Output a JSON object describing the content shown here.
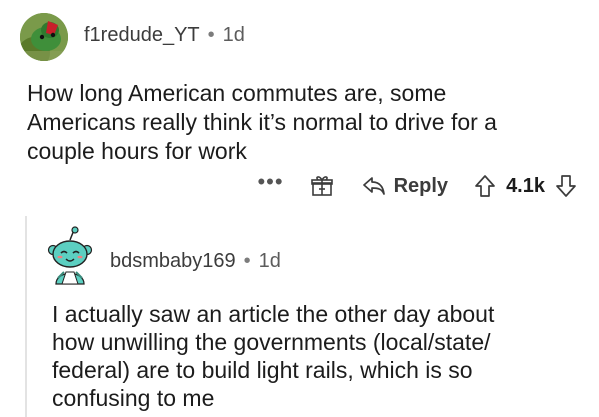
{
  "comments": [
    {
      "username": "f1redude_YT",
      "separator": "•",
      "time": "1d",
      "body_lines": [
        "How long American commutes are, some",
        "Americans really think it’s normal to drive for a",
        "couple hours for work"
      ],
      "actions": {
        "more": "•••",
        "reply_label": "Reply",
        "vote_count": "4.1k"
      }
    },
    {
      "username": "bdsmbaby169",
      "separator": "•",
      "time": "1d",
      "body_lines": [
        "I actually saw an article the other day about",
        "how unwilling the governments (local/state/",
        "federal) are to build light rails, which is so",
        "confusing to me"
      ]
    }
  ],
  "icons": {
    "avatar_1": "frog-avatar",
    "avatar_2": "snoo-avatar",
    "award": "gift-icon",
    "reply": "reply-arrow-icon",
    "upvote": "upvote-arrow-icon",
    "downvote": "downvote-arrow-icon"
  },
  "colors": {
    "text": "#1c1c1c",
    "meta": "#3c3c3c",
    "divider": "#e3e3e3",
    "snoo": "#5ccfc1"
  }
}
